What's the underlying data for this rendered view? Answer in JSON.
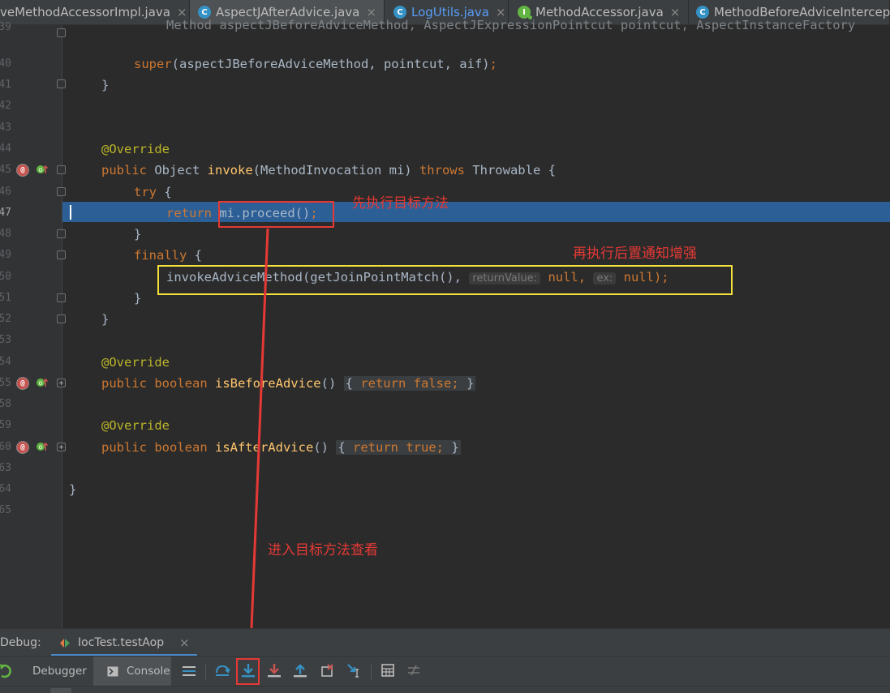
{
  "tabs": [
    {
      "label": "veMethodAccessorImpl.java",
      "icon": "none",
      "close": "×",
      "active": false,
      "color": "#bbbbbb"
    },
    {
      "label": "AspectJAfterAdvice.java",
      "icon": "class",
      "close": "×",
      "active": true,
      "color": "#bbbbbb"
    },
    {
      "label": "LogUtils.java",
      "icon": "class",
      "close": "×",
      "active": false,
      "color": "#589df6"
    },
    {
      "label": "MethodAccessor.java",
      "icon": "interface",
      "close": "×",
      "active": false,
      "color": "#bbbbbb"
    },
    {
      "label": "MethodBeforeAdviceIntercep",
      "icon": "class",
      "close": "",
      "active": false,
      "color": "#bbbbbb"
    }
  ],
  "line_numbers": [
    "39",
    "40",
    "41",
    "42",
    "43",
    "44",
    "45",
    "46",
    "47",
    "48",
    "49",
    "50",
    "51",
    "52",
    "53",
    "54",
    "55",
    "58",
    "59",
    "60",
    "63",
    "64",
    "65"
  ],
  "code": {
    "l0_rest": "Method aspectJBeforeAdviceMethod, AspectJExpressionPointcut pointcut, AspectInstanceFactory",
    "l1_super": "super",
    "l1_args": "(aspectJBeforeAdviceMethod, pointcut, aif)",
    "l1_semi": ";",
    "l2_close": "}",
    "l5_ann": "@Override",
    "l6_public": "public ",
    "l6_type": "Object ",
    "l6_name": "invoke",
    "l6_params": "(MethodInvocation mi) ",
    "l6_throws": "throws ",
    "l6_rest": "Throwable {",
    "l7_try": "try ",
    "l7_brace": "{",
    "l8_return": "return ",
    "l8_expr": "mi.proceed()",
    "l8_semi": ";",
    "l9_close": "}",
    "l10_finally": "finally ",
    "l10_brace": "{",
    "l11_call": "invokeAdviceMethod(getJoinPointMatch(), ",
    "l11_hint1": "returnValue:",
    "l11_null1": " null, ",
    "l11_hint2": "ex:",
    "l11_null2": " null)",
    "l11_semi": ";",
    "l12_close": "}",
    "l13_close": "}",
    "l15_ann": "@Override",
    "l16_public": "public ",
    "l16_bool": "boolean ",
    "l16_name": "isBeforeAdvice",
    "l16_parens": "() ",
    "l16_open": "{",
    "l16_return": " return ",
    "l16_false": "false",
    "l16_semi": "; ",
    "l16_close": "}",
    "l18_ann": "@Override",
    "l19_public": "public ",
    "l19_bool": "boolean ",
    "l19_name": "isAfterAdvice",
    "l19_parens": "() ",
    "l19_open": "{",
    "l19_return": " return ",
    "l19_true": "true",
    "l19_semi": "; ",
    "l19_close": "}",
    "l21_close": "}"
  },
  "annotations": {
    "note1": "先执行目标方法",
    "note2": "再执行后置通知增强",
    "note3": "进入目标方法查看"
  },
  "debug": {
    "label": "Debug:",
    "session": "IocTest.testAop",
    "session_close": "×",
    "tab_debugger": "Debugger",
    "tab_console": "Console"
  },
  "colors": {
    "keyword": "#cc7832",
    "annotation": "#bbb529",
    "method": "#ffc66d",
    "exec_line": "#2d5f97",
    "annotation_red": "#e53935",
    "annotation_yellow": "#f4e03a"
  },
  "toolbar_icons": [
    "show-execution-point-icon",
    "step-over-icon",
    "step-into-icon",
    "force-step-into-icon",
    "step-out-icon",
    "drop-frame-icon",
    "run-to-cursor-icon",
    "evaluate-expression-icon",
    "trace-icon"
  ]
}
